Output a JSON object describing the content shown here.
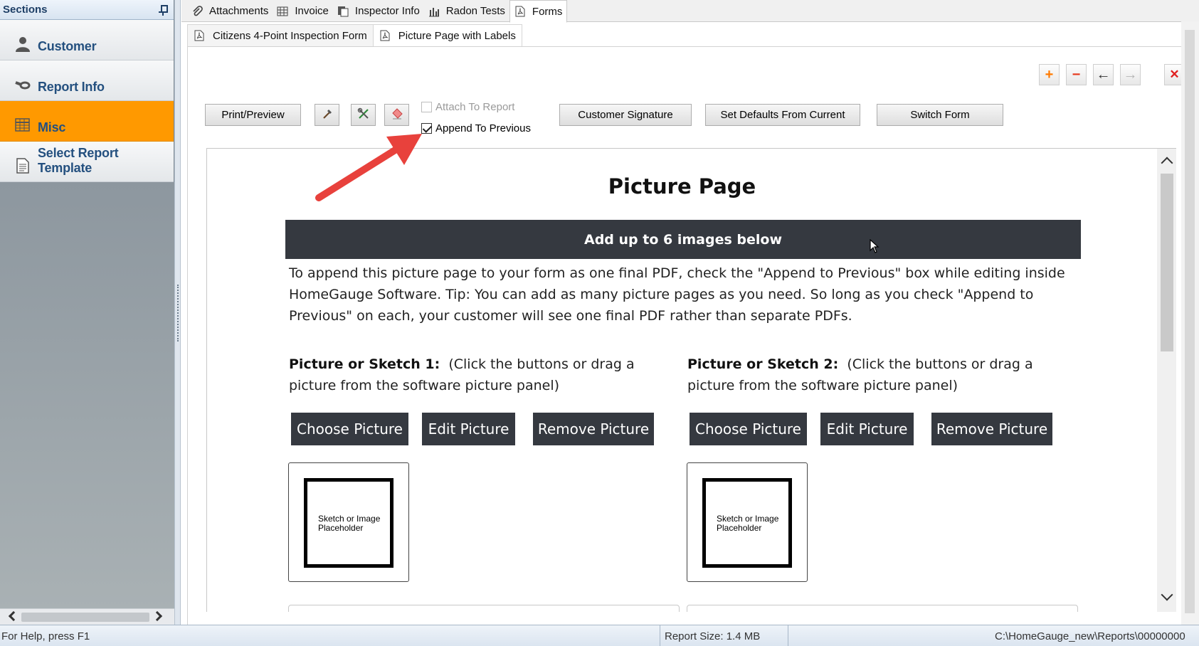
{
  "sidebar": {
    "title": "Sections",
    "items": [
      {
        "label": "Customer",
        "icon": "person-icon",
        "active": false
      },
      {
        "label": "Report Info",
        "icon": "magnifier-icon",
        "active": false
      },
      {
        "label": "Misc",
        "icon": "grid-icon",
        "active": true
      },
      {
        "label": "Select Report Template",
        "icon": "document-icon",
        "active": false
      }
    ]
  },
  "top_tabs": [
    {
      "label": "Attachments",
      "icon": "paperclip-icon"
    },
    {
      "label": "Invoice",
      "icon": "spreadsheet-icon"
    },
    {
      "label": "Inspector Info",
      "icon": "copy-pages-icon"
    },
    {
      "label": "Radon Tests",
      "icon": "bar-chart-icon"
    },
    {
      "label": "Forms",
      "icon": "pdf-icon",
      "active": true
    }
  ],
  "sub_tabs": [
    {
      "label": "Citizens 4-Point Inspection Form",
      "icon": "pdf-icon"
    },
    {
      "label": "Picture Page with Labels",
      "icon": "pdf-icon",
      "active": true
    }
  ],
  "form_actions": {
    "add": "+",
    "remove": "−",
    "back": "←",
    "forward": "→",
    "close": "✕"
  },
  "toolbar": {
    "print_preview": "Print/Preview",
    "attach_to_report": "Attach To Report",
    "append_to_previous": "Append To Previous",
    "customer_signature": "Customer Signature",
    "set_defaults": "Set Defaults From Current",
    "switch_form": "Switch Form"
  },
  "document": {
    "title": "Picture Page",
    "banner": "Add up to 6 images below",
    "intro": "To append this picture page to your form as one final PDF, check the \"Append to Previous\" box while editing inside HomeGauge Software. Tip: You can add as many picture pages as you need. So long as you check \"Append to Previous\" on each, your customer will see one final PDF rather than separate PDFs.",
    "pictures": [
      {
        "heading": "Picture or Sketch 1:",
        "hint": "(Click the buttons or drag a picture from the software picture panel)",
        "choose": "Choose Picture",
        "edit": "Edit Picture",
        "remove": "Remove Picture",
        "placeholder": "Sketch or Image Placeholder"
      },
      {
        "heading": "Picture or Sketch 2:",
        "hint": "(Click the buttons or drag a picture from the software picture panel)",
        "choose": "Choose Picture",
        "edit": "Edit Picture",
        "remove": "Remove Picture",
        "placeholder": "Sketch or Image Placeholder"
      }
    ]
  },
  "statusbar": {
    "help": "For Help, press F1",
    "report_size": "Report Size: 1.4 MB",
    "path": "C:\\HomeGauge_new\\Reports\\00000000"
  },
  "colors": {
    "active_section": "#ff9900",
    "section_label": "#24507f",
    "doc_dark": "#353940",
    "annotation_arrow": "#e8413c",
    "add_icon": "#ff7a00",
    "close_icon": "#e02020"
  }
}
